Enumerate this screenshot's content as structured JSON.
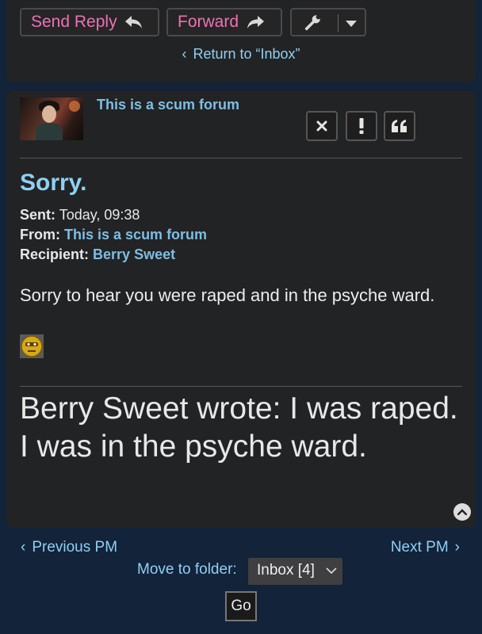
{
  "toolbar": {
    "send_reply_label": "Send Reply",
    "forward_label": "Forward",
    "return_label": "Return to “Inbox”",
    "accent_color": "#ec72b5"
  },
  "message": {
    "poster_name": "This is a scum forum",
    "title": "Sorry.",
    "sent_label": "Sent:",
    "sent_value": "Today, 09:38",
    "from_label": "From:",
    "from_value": "This is a scum forum",
    "recipient_label": "Recipient:",
    "recipient_value": "Berry Sweet",
    "body": "Sorry to hear you were raped and in the psyche ward.",
    "quote": "Berry Sweet wrote: I was raped. I was in the psyche ward."
  },
  "actions": [
    "close-icon",
    "report-icon",
    "quote-icon"
  ],
  "footer": {
    "prev_label": "Previous PM",
    "next_label": "Next PM",
    "move_label": "Move to folder:",
    "folder_value": "Inbox [4]",
    "go_label": "Go"
  }
}
